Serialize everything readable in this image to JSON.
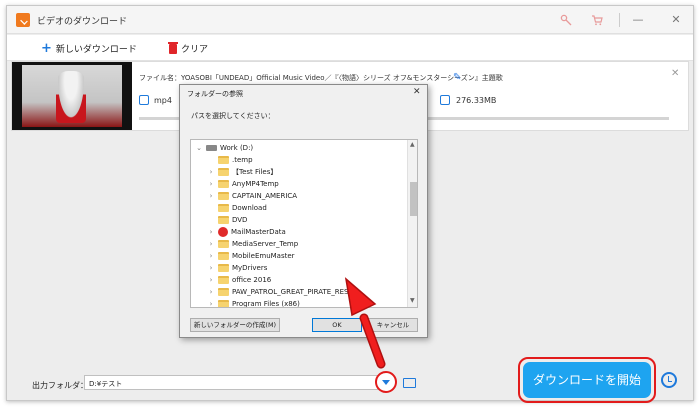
{
  "app": {
    "title": "ビデオのダウンロード"
  },
  "window_controls": {
    "minimize": "—",
    "close": "✕"
  },
  "toolbar": {
    "new_download_icon": "+",
    "new_download_label": "新しいダウンロード",
    "clear_label": "クリア"
  },
  "file_item": {
    "name_line": "ファイル名：YOASOBI「UNDEAD」Official Music Video／『〈物語〉シリーズ オフ&モンスターシーズン』主題歌",
    "format": "mp4",
    "size": "276.33MB",
    "close": "✕",
    "edit_icon": "✎"
  },
  "dialog": {
    "title": "フォルダーの参照",
    "close": "✕",
    "prompt": "パスを選択してください：",
    "tree_items": [
      {
        "chevron": "⌄",
        "label": "Work (D:)"
      },
      {
        "chevron": "",
        "label": ".temp"
      },
      {
        "chevron": "›",
        "label": "【Test Files】"
      },
      {
        "chevron": "›",
        "label": "AnyMP4Temp"
      },
      {
        "chevron": "›",
        "label": "CAPTAIN_AMERICA"
      },
      {
        "chevron": "",
        "label": "Download"
      },
      {
        "chevron": "",
        "label": "DVD"
      },
      {
        "chevron": "›",
        "label": "MailMasterData"
      },
      {
        "chevron": "›",
        "label": "MediaServer_Temp"
      },
      {
        "chevron": "›",
        "label": "MobileEmuMaster"
      },
      {
        "chevron": "›",
        "label": "MyDrivers"
      },
      {
        "chevron": "›",
        "label": "office 2016"
      },
      {
        "chevron": "›",
        "label": "PAW_PATROL_GREAT_PIRATE_RES"
      },
      {
        "chevron": "›",
        "label": "Program Files (x86)"
      }
    ],
    "scroll_up": "▲",
    "scroll_down": "▼",
    "new_folder_label": "新しいフォルダーの作成(M)",
    "ok_label": "OK",
    "cancel_label": "キャンセル"
  },
  "footer": {
    "output_label": "出力フォルダ：",
    "output_path": "D:¥テスト",
    "start_label": "ダウンロードを開始"
  },
  "colors": {
    "accent_blue": "#1ea4f0",
    "highlight_red": "#e21b1b",
    "icon_blue": "#1f7adb"
  }
}
